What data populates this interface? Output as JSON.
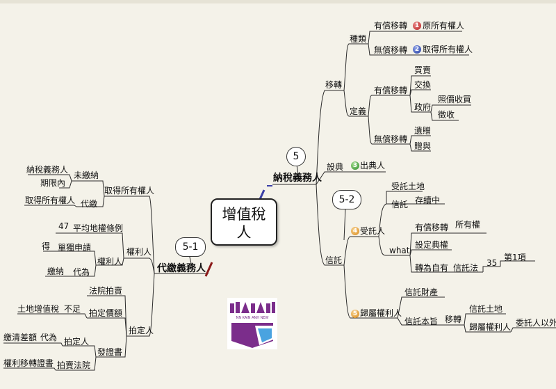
{
  "center": {
    "line1": "增值稅",
    "line2": "人"
  },
  "callouts": {
    "c5": "5",
    "c5_1": "5-1",
    "c5_2": "5-2"
  },
  "right": {
    "main": "納稅義務人",
    "transfer": "移轉",
    "types": "種類",
    "paid_transfer_1": "有償移轉",
    "badge1": "1",
    "original_owner": "原所有權人",
    "free_transfer_1": "無償移轉",
    "badge2": "2",
    "acquiring_owner": "取得所有權人",
    "definition": "定義",
    "paid_transfer_2": "有償移轉",
    "sale": "買賣",
    "exchange": "交換",
    "government": "政府",
    "price_purchase": "照價收買",
    "expropriation": "徵收",
    "free_transfer_2": "無償移轉",
    "bequest": "遺贈",
    "gift": "贈與",
    "dian": "設典",
    "badge3": "3",
    "dian_holder": "出典人",
    "trust": "信託",
    "badge4": "4",
    "trustee": "受託人",
    "trust_land_1": "受託土地",
    "trust_word": "信託",
    "in_force": "存續中",
    "what": "what",
    "paid_transfer_3": "有償移轉",
    "ownership": "所有權",
    "set_dian": "設定典權",
    "to_self": "轉為自有",
    "trust_law": "信託法",
    "art35": "35",
    "item1": "第1項",
    "badge5": "5",
    "beneficiary": "歸屬權利人",
    "trust_property": "信託財產",
    "trust_purpose": "信託本旨",
    "transfer_2": "移轉",
    "trust_land_2": "信託土地",
    "beneficiary_2": "歸屬權利人",
    "not_settlor": "委託人以外"
  },
  "left": {
    "main": "代繳義務人",
    "acquire_owner": "取得所有權人",
    "unpaid": "未繳納",
    "taxpayer": "納稅義務人",
    "deadline": "期限內",
    "pay_on_behalf": "代繳",
    "acquire_owner_2": "取得所有權人",
    "rights_holder": "權利人",
    "art_pinjun": "平均地權條例",
    "n47": "47",
    "sole_apply": "單獨申請",
    "de": "得",
    "rights_holder_2": "權利人",
    "pay": "繳納",
    "on_behalf": "代為",
    "winning_bidder": "拍定人",
    "court_auction": "法院拍賣",
    "auction_price": "拍定價額",
    "insufficient": "不足",
    "land_vat": "土地增值稅",
    "winning_bidder_2": "拍定人",
    "on_behalf_2": "代為",
    "pay_off": "繳清差額",
    "issue": "發證書",
    "transfer_cert": "權利移轉證書",
    "auction_court": "拍賣法院"
  },
  "logo": {
    "caption": "NN KAIN ANH NEW"
  },
  "colors": {
    "background": "#f4f2e9",
    "right_branch": "#3a3fa6",
    "left_branch": "#8b1a1a",
    "lines": "#2b2b2b"
  }
}
